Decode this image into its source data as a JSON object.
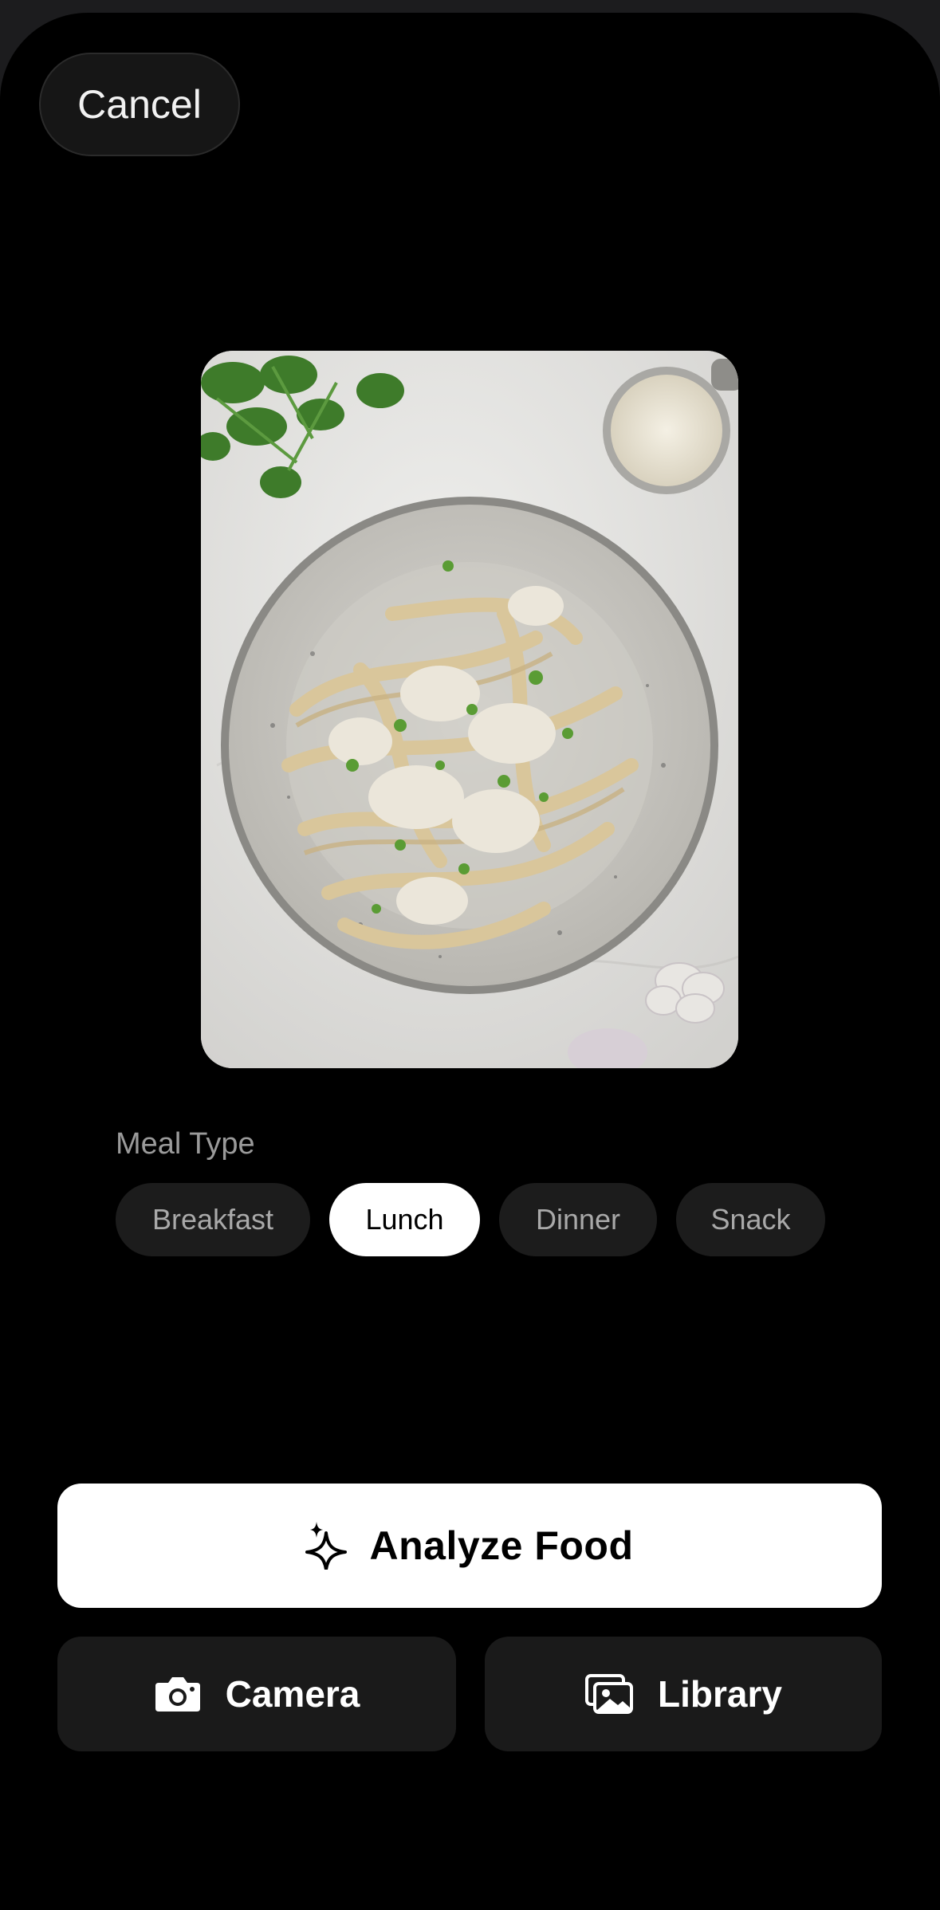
{
  "header": {
    "cancel_label": "Cancel"
  },
  "photo": {
    "subject": "creamy-chicken-fettuccine-plate"
  },
  "meal_type": {
    "label": "Meal Type",
    "options": [
      "Breakfast",
      "Lunch",
      "Dinner",
      "Snack"
    ],
    "selected": "Lunch"
  },
  "actions": {
    "analyze_label": "Analyze Food",
    "analyze_icon": "sparkle-icon",
    "camera_label": "Camera",
    "camera_icon": "camera-icon",
    "library_label": "Library",
    "library_icon": "photo-library-icon"
  },
  "colors": {
    "background": "#000000",
    "chip_active": "#ffffff",
    "chip_inactive": "#1c1c1c",
    "button_dark": "#1a1a1a"
  }
}
